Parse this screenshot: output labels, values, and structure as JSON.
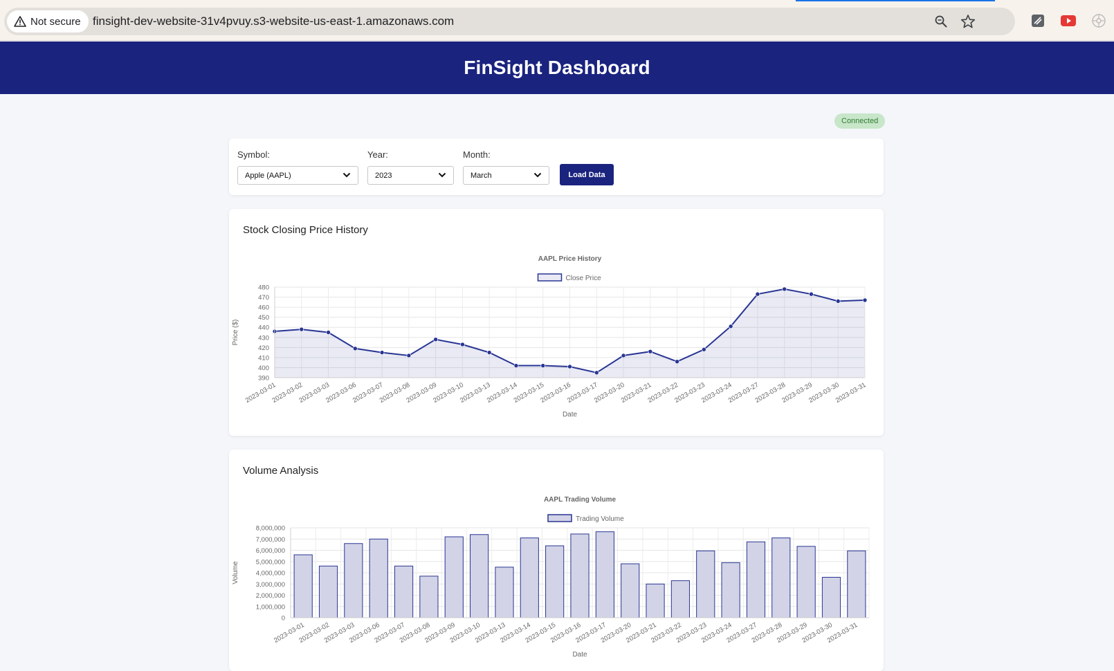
{
  "browser": {
    "security_label": "Not secure",
    "url": "finsight-dev-website-31v4pvuy.s3-website-us-east-1.amazonaws.com",
    "icons": [
      "warning-icon",
      "zoom-icon",
      "bookmark-star-icon",
      "extension-icon",
      "youtube-extension-icon",
      "extensions-icon"
    ]
  },
  "header": {
    "title": "FinSight Dashboard"
  },
  "status": {
    "label": "Connected",
    "color": "#2e7d32"
  },
  "controls": {
    "symbol_label": "Symbol:",
    "symbol_value": "Apple (AAPL)",
    "year_label": "Year:",
    "year_value": "2023",
    "month_label": "Month:",
    "month_value": "March",
    "load_button": "Load Data"
  },
  "price_section": {
    "heading": "Stock Closing Price History"
  },
  "volume_section": {
    "heading": "Volume Analysis"
  },
  "colors": {
    "brand": "#1a237e",
    "series": "#283593",
    "fill": "rgba(40,53,147,0.10)",
    "bar_fill": "#d2d3e6"
  },
  "chart_data": [
    {
      "type": "line",
      "title": "AAPL Price History",
      "legend": [
        "Close Price"
      ],
      "legend_position": "top",
      "xlabel": "Date",
      "ylabel": "Price ($)",
      "ylim": [
        390,
        480
      ],
      "yticks": [
        390,
        400,
        410,
        420,
        430,
        440,
        450,
        460,
        470,
        480
      ],
      "grid": true,
      "categories": [
        "2023-03-01",
        "2023-03-02",
        "2023-03-03",
        "2023-03-06",
        "2023-03-07",
        "2023-03-08",
        "2023-03-09",
        "2023-03-10",
        "2023-03-13",
        "2023-03-14",
        "2023-03-15",
        "2023-03-16",
        "2023-03-17",
        "2023-03-20",
        "2023-03-21",
        "2023-03-22",
        "2023-03-23",
        "2023-03-24",
        "2023-03-27",
        "2023-03-28",
        "2023-03-29",
        "2023-03-30",
        "2023-03-31"
      ],
      "series": [
        {
          "name": "Close Price",
          "values": [
            436,
            438,
            435,
            419,
            415,
            412,
            428,
            423,
            415,
            402,
            402,
            401,
            395,
            412,
            416,
            406,
            418,
            441,
            473,
            478,
            473,
            466,
            467
          ]
        }
      ]
    },
    {
      "type": "bar",
      "title": "AAPL Trading Volume",
      "legend": [
        "Trading Volume"
      ],
      "legend_position": "top",
      "xlabel": "Date",
      "ylabel": "Volume",
      "ylim": [
        0,
        8000000
      ],
      "yticks": [
        "0",
        "1,000,000",
        "2,000,000",
        "3,000,000",
        "4,000,000",
        "5,000,000",
        "6,000,000",
        "7,000,000",
        "8,000,000"
      ],
      "grid": true,
      "categories": [
        "2023-03-01",
        "2023-03-02",
        "2023-03-03",
        "2023-03-06",
        "2023-03-07",
        "2023-03-08",
        "2023-03-09",
        "2023-03-10",
        "2023-03-13",
        "2023-03-14",
        "2023-03-15",
        "2023-03-16",
        "2023-03-17",
        "2023-03-20",
        "2023-03-21",
        "2023-03-22",
        "2023-03-23",
        "2023-03-24",
        "2023-03-27",
        "2023-03-28",
        "2023-03-29",
        "2023-03-30",
        "2023-03-31"
      ],
      "series": [
        {
          "name": "Trading Volume",
          "values": [
            5600000,
            4600000,
            6600000,
            7000000,
            4600000,
            3700000,
            7200000,
            7400000,
            4500000,
            7100000,
            6400000,
            7450000,
            7650000,
            4800000,
            3000000,
            3300000,
            5950000,
            4900000,
            6750000,
            7100000,
            6350000,
            3600000,
            5950000
          ]
        }
      ]
    }
  ]
}
